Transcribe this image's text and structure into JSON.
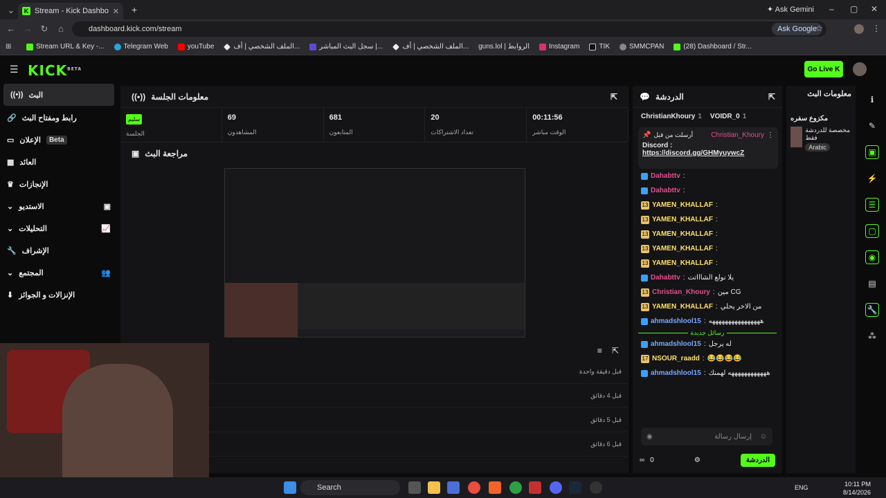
{
  "browser": {
    "tab_title": "Stream - Kick Dashboard",
    "url": "dashboard.kick.com/stream",
    "ask_gemini": "Ask Gemini",
    "ask_google": "Ask Google",
    "bookmarks": [
      "Stream URL & Key -...",
      "Telegram Web",
      "youTube",
      "الملف الشخصي | أف...",
      "سجل البث المباشر |...",
      "الملف الشخصي | أف...",
      "guns.lol | الروابط",
      "Instagram",
      "TIK",
      "SMMCPAN",
      "(28) Dashboard / Str..."
    ]
  },
  "header": {
    "logo": "KICK",
    "beta": "BETA",
    "go_live": "Go Live"
  },
  "sidebar": {
    "items": [
      {
        "label": "البث"
      },
      {
        "label": "رابط ومفتاح البث"
      },
      {
        "label": "الإعلان",
        "badge": "Beta"
      },
      {
        "label": "العائد"
      },
      {
        "label": "الإنجازات"
      },
      {
        "label": "الاستديو"
      },
      {
        "label": "التحليلات"
      },
      {
        "label": "الإشراف"
      },
      {
        "label": "المجتمع"
      },
      {
        "label": "الإنزالات و الجوائز"
      }
    ]
  },
  "session": {
    "title": "معلومات الجلسة",
    "badge": "سليم",
    "stats": [
      {
        "value": "",
        "label": "الجلسة"
      },
      {
        "value": "69",
        "label": "المشاهدون"
      },
      {
        "value": "681",
        "label": "المتابعون"
      },
      {
        "value": "20",
        "label": "تعداد الاشتراكات"
      },
      {
        "value": "00:11:56",
        "label": "الوقت مباشر"
      }
    ],
    "review_title": "مراجعة البث"
  },
  "activity": {
    "rows": [
      "قبل دقيقة واحدة",
      "قبل 4 دقائق",
      "قبل 5 دقائق",
      "قبل 6 دقائق"
    ]
  },
  "chat": {
    "title": "الدردشة",
    "top_users": [
      "ChristianKhoury",
      "VOIDR_0"
    ],
    "pinned": {
      "label": "أرسلت من قبل",
      "user": "Christian_Khoury",
      "text": "Discord :",
      "link": "https://discord.gg/GHMyuywcZ"
    },
    "lines": [
      {
        "user": "Dahabttv",
        "text": ""
      },
      {
        "user": "Dahabttv",
        "text": ""
      },
      {
        "user": "YAMEN_KHALLAF",
        "text": ""
      },
      {
        "user": "YAMEN_KHALLAF",
        "text": ""
      },
      {
        "user": "YAMEN_KHALLAF",
        "text": ""
      },
      {
        "user": "YAMEN_KHALLAF",
        "text": ""
      },
      {
        "user": "YAMEN_KHALLAF",
        "text": ""
      },
      {
        "user": "Dahabttv",
        "text": "يلا نولع الشاااتت"
      },
      {
        "user": "Christian_Khoury",
        "text": "مين CG"
      },
      {
        "user": "YAMEN_KHALLAF",
        "text": "من الاخر يحلي"
      },
      {
        "user": "ahmadshlool15",
        "text": "ههههههههههههههههه"
      }
    ],
    "new_messages": "رسائل جديدة",
    "lines2": [
      {
        "user": "ahmadshlool15",
        "text": "له يرجل"
      },
      {
        "user": "NSOUR_raadd",
        "text": "😂😂😂😂"
      },
      {
        "user": "ahmadshlool15",
        "text": "ههههههههههههه لهمنك"
      }
    ],
    "input_placeholder": "إرسال رسالة",
    "count": "0",
    "send": "الدردشة"
  },
  "info": {
    "title": "معلومات البث",
    "stream_title": "مكزوع سفره",
    "tag_line": "مخصصة للدردشة فقط",
    "language": "Arabic"
  },
  "taskbar": {
    "search": "Search",
    "lang": "ENG",
    "time": "10:11 PM",
    "date": "8/14/2026"
  }
}
